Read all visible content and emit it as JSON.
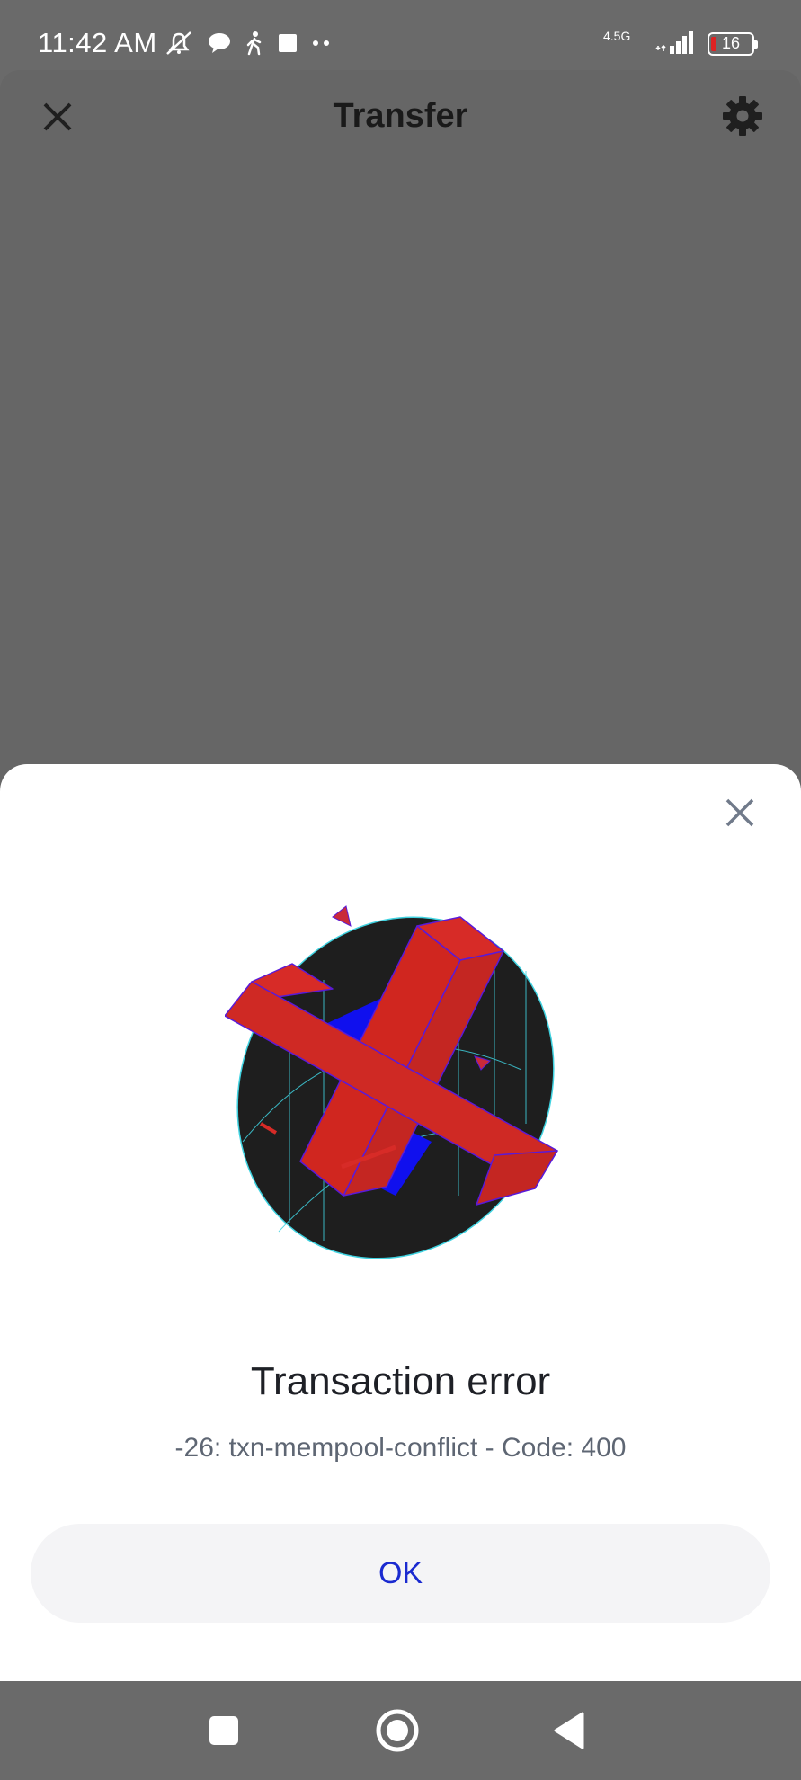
{
  "status_bar": {
    "time": "11:42 AM",
    "network": "4.5G",
    "battery": "16"
  },
  "header": {
    "title": "Transfer",
    "close_icon": "close-icon",
    "settings_icon": "gear-icon"
  },
  "modal": {
    "title": "Transaction error",
    "message": "-26: txn-mempool-conflict - Code: 400",
    "ok_label": "OK",
    "illustration": "error-cross-illustration"
  },
  "colors": {
    "accent": "#1a2ad0",
    "error_red": "#cc2a26",
    "scrim": "#666666"
  }
}
